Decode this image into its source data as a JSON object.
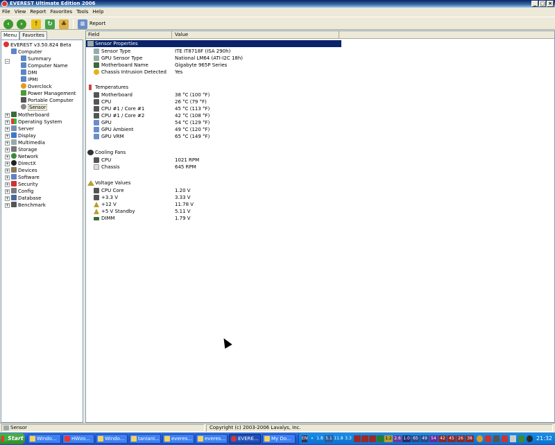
{
  "window": {
    "title": "EVEREST Ultimate Edition 2006",
    "controls": {
      "minimize": "_",
      "maximize": "□",
      "close": "×"
    }
  },
  "menu": [
    "File",
    "View",
    "Report",
    "Favorites",
    "Tools",
    "Help"
  ],
  "toolbar": {
    "report_label": "Report"
  },
  "tabs": [
    "Menu",
    "Favorites"
  ],
  "tree": {
    "root": "EVEREST v3.50.824 Beta",
    "computer": "Computer",
    "computer_children": [
      "Summary",
      "Computer Name",
      "DMI",
      "IPMI",
      "Overclock",
      "Power Management",
      "Portable Computer",
      "Sensor"
    ],
    "categories": [
      "Motherboard",
      "Operating System",
      "Server",
      "Display",
      "Multimedia",
      "Storage",
      "Network",
      "DirectX",
      "Devices",
      "Software",
      "Security",
      "Config",
      "Database",
      "Benchmark"
    ]
  },
  "columns": {
    "field": "Field",
    "value": "Value"
  },
  "sections": {
    "sensor_properties": {
      "title": "Sensor Properties",
      "rows": [
        {
          "field": "Sensor Type",
          "value": "ITE IT8718F  (ISA 290h)"
        },
        {
          "field": "GPU Sensor Type",
          "value": "National LM64  (ATI-I2C 18h)"
        },
        {
          "field": "Motherboard Name",
          "value": "Gigabyte 965P Series"
        },
        {
          "field": "Chassis Intrusion Detected",
          "value": "Yes"
        }
      ]
    },
    "temperatures": {
      "title": "Temperatures",
      "rows": [
        {
          "field": "Motherboard",
          "value": "38 °C  (100 °F)"
        },
        {
          "field": "CPU",
          "value": "26 °C  (79 °F)"
        },
        {
          "field": "CPU #1 / Core #1",
          "value": "45 °C  (113 °F)"
        },
        {
          "field": "CPU #1 / Core #2",
          "value": "42 °C  (108 °F)"
        },
        {
          "field": "GPU",
          "value": "54 °C  (129 °F)"
        },
        {
          "field": "GPU Ambient",
          "value": "49 °C  (120 °F)"
        },
        {
          "field": "GPU VRM",
          "value": "65 °C  (149 °F)"
        }
      ]
    },
    "cooling_fans": {
      "title": "Cooling Fans",
      "rows": [
        {
          "field": "CPU",
          "value": "1021 RPM"
        },
        {
          "field": "Chassis",
          "value": "645 RPM"
        }
      ]
    },
    "voltage_values": {
      "title": "Voltage Values",
      "rows": [
        {
          "field": "CPU Core",
          "value": "1.20 V"
        },
        {
          "field": "+3.3 V",
          "value": "3.33 V"
        },
        {
          "field": "+12 V",
          "value": "11.78 V"
        },
        {
          "field": "+5 V Standby",
          "value": "5.11 V"
        },
        {
          "field": "DIMM",
          "value": "1.79 V"
        }
      ]
    }
  },
  "statusbar": {
    "left": "Sensor",
    "right": "Copyright (c) 2003-2006 Lavalys, Inc."
  },
  "taskbar": {
    "start": "Start",
    "tasks": [
      "Windo...",
      "HWzo...",
      "Windo...",
      "taniani...",
      "everes...",
      "everes...",
      "EVERE...",
      "My Do..."
    ],
    "tray_readouts": [
      "1.8",
      "5.1",
      "11.8",
      "3.3",
      "1.2",
      "2.6",
      "1.0",
      "65",
      "49",
      "54",
      "42",
      "45",
      "26",
      "38"
    ],
    "clock": "21:32"
  },
  "colors": {
    "selection": "#0a246a",
    "title_gradient_start": "#0a246a",
    "taskbar": "#245edb",
    "start_button": "#3c9a2f"
  }
}
